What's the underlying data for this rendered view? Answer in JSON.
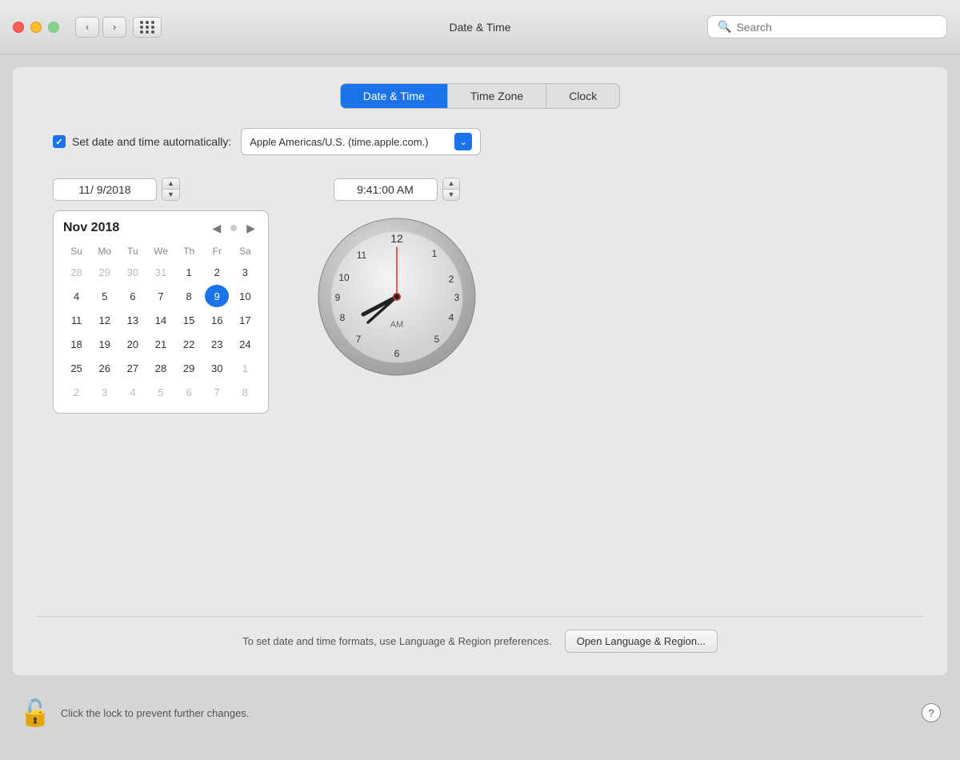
{
  "titlebar": {
    "title": "Date & Time",
    "search_placeholder": "Search"
  },
  "tabs": [
    {
      "id": "date-time",
      "label": "Date & Time",
      "active": true
    },
    {
      "id": "time-zone",
      "label": "Time Zone",
      "active": false
    },
    {
      "id": "clock",
      "label": "Clock",
      "active": false
    }
  ],
  "auto_set": {
    "label": "Set date and time automatically:",
    "checked": true,
    "server": "Apple Americas/U.S. (time.apple.com.)"
  },
  "date": {
    "value": "11/  9/2018"
  },
  "time": {
    "value": "9:41:00 AM"
  },
  "calendar": {
    "month_year": "Nov 2018",
    "day_headers": [
      "Su",
      "Mo",
      "Tu",
      "We",
      "Th",
      "Fr",
      "Sa"
    ],
    "weeks": [
      [
        {
          "day": "28",
          "other": true
        },
        {
          "day": "29",
          "other": true
        },
        {
          "day": "30",
          "other": true
        },
        {
          "day": "31",
          "other": true
        },
        {
          "day": "1",
          "other": false
        },
        {
          "day": "2",
          "other": false
        },
        {
          "day": "3",
          "other": false
        }
      ],
      [
        {
          "day": "4",
          "other": false
        },
        {
          "day": "5",
          "other": false
        },
        {
          "day": "6",
          "other": false
        },
        {
          "day": "7",
          "other": false
        },
        {
          "day": "8",
          "other": false
        },
        {
          "day": "9",
          "other": false,
          "selected": true
        },
        {
          "day": "10",
          "other": false
        }
      ],
      [
        {
          "day": "11",
          "other": false
        },
        {
          "day": "12",
          "other": false
        },
        {
          "day": "13",
          "other": false
        },
        {
          "day": "14",
          "other": false
        },
        {
          "day": "15",
          "other": false
        },
        {
          "day": "16",
          "other": false
        },
        {
          "day": "17",
          "other": false
        }
      ],
      [
        {
          "day": "18",
          "other": false
        },
        {
          "day": "19",
          "other": false
        },
        {
          "day": "20",
          "other": false
        },
        {
          "day": "21",
          "other": false
        },
        {
          "day": "22",
          "other": false
        },
        {
          "day": "23",
          "other": false
        },
        {
          "day": "24",
          "other": false
        }
      ],
      [
        {
          "day": "25",
          "other": false
        },
        {
          "day": "26",
          "other": false
        },
        {
          "day": "27",
          "other": false
        },
        {
          "day": "28",
          "other": false
        },
        {
          "day": "29",
          "other": false
        },
        {
          "day": "30",
          "other": false
        },
        {
          "day": "1",
          "other": true
        }
      ],
      [
        {
          "day": "2",
          "other": true
        },
        {
          "day": "3",
          "other": true
        },
        {
          "day": "4",
          "other": true
        },
        {
          "day": "5",
          "other": true
        },
        {
          "day": "6",
          "other": true
        },
        {
          "day": "7",
          "other": true
        },
        {
          "day": "8",
          "other": true
        }
      ]
    ]
  },
  "clock": {
    "am_label": "AM",
    "hour": 9,
    "minute": 41,
    "second": 0
  },
  "bottom": {
    "description": "To set date and time formats, use Language & Region preferences.",
    "open_button": "Open Language & Region..."
  },
  "footer": {
    "lock_text": "Click the lock to prevent further changes.",
    "help": "?"
  }
}
